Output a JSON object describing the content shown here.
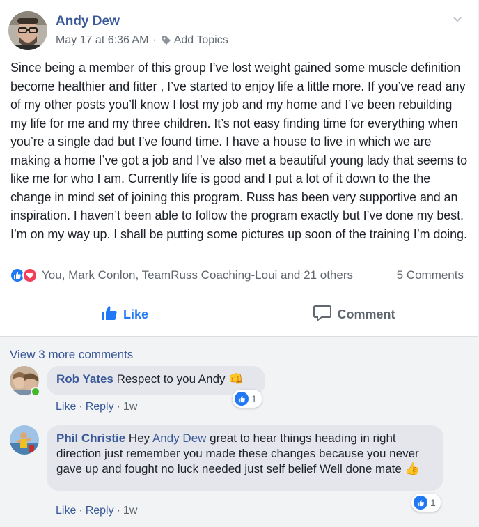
{
  "post": {
    "author": "Andy Dew",
    "timestamp": "May 17 at 6:36 AM",
    "separator": "·",
    "add_topics": "Add Topics",
    "body": "Since being a member of this group I’ve lost weight gained some muscle definition become healthier and fitter , I’ve started to enjoy life a little more. If you’ve read any of my other posts you’ll know I lost my job and my home and I’ve been rebuilding my life for me and my three children. It’s not easy finding time for everything when you’re a single dad but I’ve found time. I have a house to live in which we are making a home I’ve got a job and I’ve also met a beautiful young lady that seems to like me for who I am. Currently life is good and I put a lot of it down to the the change in mind set of joining this program. Russ has been very supportive and an inspiration. I haven’t been able to follow the program exactly but I’ve done my best. I’m on my way up. I shall be putting some pictures up soon of the training I’m doing.",
    "reactions_text": "You, Mark Conlon, TeamRuss Coaching-Loui and 21 others",
    "comments_count": "5 Comments"
  },
  "actions": {
    "like": "Like",
    "comment": "Comment"
  },
  "comments": {
    "view_more": "View 3 more comments",
    "items": [
      {
        "name": "Rob Yates",
        "text": "Respect to you Andy",
        "emoji": "👊",
        "like": "Like",
        "reply": "Reply",
        "time": "1w",
        "reaction_count": "1",
        "online": true
      },
      {
        "name": "Phil Christie",
        "text_before": "Hey",
        "mention": "Andy Dew",
        "text_after": "great to hear things heading in right direction just remember you made these changes because you never gave up and fought no luck needed just self belief Well done mate",
        "emoji": "👍",
        "like": "Like",
        "reply": "Reply",
        "time": "1w",
        "reaction_count": "1"
      }
    ]
  },
  "colors": {
    "link_blue": "#385898",
    "like_blue": "#2078f4",
    "love_red": "#f33e58",
    "meta_gray": "#606770",
    "bubble_gray": "#e4e6eb",
    "online_green": "#42b72a"
  },
  "icons": [
    "avatar",
    "chevron-down-icon",
    "tag-icon",
    "like-reaction-icon",
    "love-reaction-icon",
    "thumbs-up-icon",
    "comment-icon",
    "online-indicator"
  ]
}
